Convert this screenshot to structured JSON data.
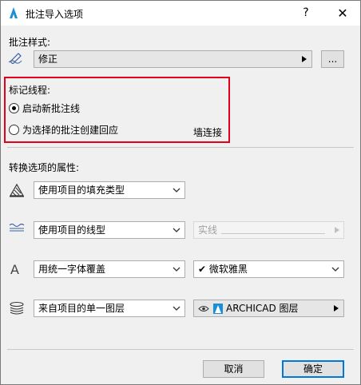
{
  "window": {
    "title": "批注导入选项",
    "help_glyph": "?",
    "close_glyph": "✕"
  },
  "markup_style": {
    "label": "批注样式:",
    "value": "修正",
    "more_button": "..."
  },
  "markup_thread": {
    "label": "标记线程:",
    "options": [
      {
        "label": "启动新批注线",
        "checked": true
      },
      {
        "label": "为选择的批注创建回应",
        "checked": false
      }
    ],
    "extra_text": "墙连接"
  },
  "converted_attributes": {
    "label": "转换选项的属性:",
    "fill": {
      "icon": "fill-type-icon",
      "value": "使用项目的填充类型"
    },
    "line": {
      "icon": "line-type-icon",
      "value": "使用项目的线型",
      "secondary": "实线",
      "secondary_disabled": true
    },
    "font": {
      "icon": "font-icon",
      "icon_glyph": "A",
      "value": "用统一字体覆盖",
      "secondary_check": "✔",
      "secondary": "微软雅黑"
    },
    "layer": {
      "icon": "layers-icon",
      "value": "来自项目的单一图层",
      "secondary": "ARCHICAD 图层"
    }
  },
  "footer": {
    "cancel": "取消",
    "ok": "确定"
  },
  "colors": {
    "highlight_box": "#e3001b",
    "default_button_border": "#0078d7",
    "logo_blue": "#1b8fd6"
  }
}
